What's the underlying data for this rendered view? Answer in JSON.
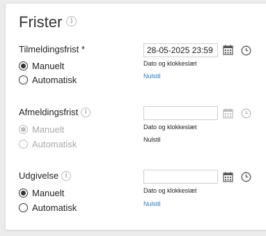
{
  "title": "Frister",
  "sections": [
    {
      "label": "Tilmeldingsfrist *",
      "options": [
        "Manuelt",
        "Automatisk"
      ],
      "date_value": "28-05-2025 23:59",
      "hint": "Dato og klokkeslæt",
      "reset": "Nulstil"
    },
    {
      "label": "Afmeldingsfrist",
      "options": [
        "Manuelt",
        "Automatisk"
      ],
      "date_value": "",
      "hint": "Dato og klokkeslæt",
      "reset": "Nulstil"
    },
    {
      "label": "Udgivelse",
      "options": [
        "Manuelt",
        "Automatisk"
      ],
      "date_value": "",
      "hint": "Dato og klokkeslæt",
      "reset": "Nulstil"
    }
  ],
  "icons": {
    "info": "info-icon",
    "calendar": "calendar-icon",
    "clock": "clock-icon"
  },
  "colors": {
    "link": "#2a7ab8",
    "disabled": "#aaaaaa",
    "border": "#cfcfcf"
  }
}
